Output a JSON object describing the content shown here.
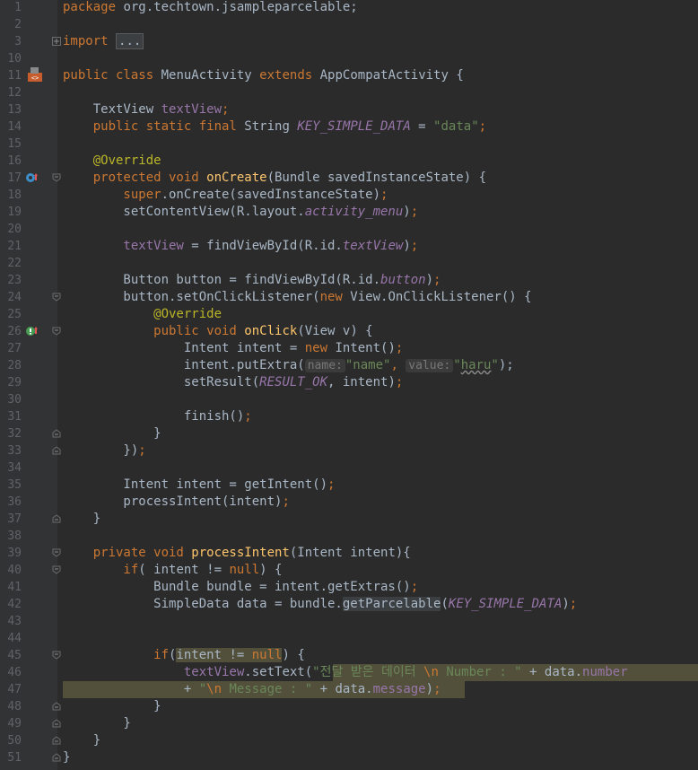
{
  "gutter": {
    "line_numbers": [
      "1",
      "2",
      "3",
      "10",
      "11",
      "12",
      "13",
      "14",
      "15",
      "16",
      "17",
      "18",
      "19",
      "20",
      "21",
      "22",
      "23",
      "24",
      "25",
      "26",
      "27",
      "28",
      "29",
      "30",
      "31",
      "32",
      "33",
      "34",
      "35",
      "36",
      "37",
      "38",
      "39",
      "40",
      "41",
      "42",
      "43",
      "44",
      "45",
      "46",
      "47",
      "48",
      "49",
      "50",
      "51"
    ]
  },
  "code": {
    "l1_kw": "package",
    "l1_rest": " org.techtown.jsampleparcelable;",
    "l3_kw": "import",
    "l3_folded": "...",
    "l11_a": "public class",
    "l11_b": " MenuActivity ",
    "l11_c": "extends",
    "l11_d": " AppCompatActivity {",
    "l13_a": "    TextView ",
    "l13_b": "textView",
    "l13_c": ";",
    "l14_a": "    public static final",
    "l14_b": " String ",
    "l14_c": "KEY_SIMPLE_DATA",
    "l14_d": " = ",
    "l14_e": "\"data\"",
    "l14_f": ";",
    "l16_a": "    @Override",
    "l17_a": "    protected void",
    "l17_b": " onCreate",
    "l17_c": "(Bundle savedInstanceState) {",
    "l18_a": "        super",
    "l18_b": ".onCreate(savedInstanceState)",
    "l18_c": ";",
    "l19_a": "        setContentView(R.layout.",
    "l19_b": "activity_menu",
    "l19_c": ")",
    "l19_d": ";",
    "l21_a": "        textView",
    "l21_b": " = findViewById(R.id.",
    "l21_c": "textView",
    "l21_d": ")",
    "l21_e": ";",
    "l23_a": "        Button button = findViewById(R.id.",
    "l23_b": "button",
    "l23_c": ")",
    "l23_d": ";",
    "l24_a": "        button.setOnClickListener(",
    "l24_b": "new",
    "l24_c": " View.OnClickListener() {",
    "l25_a": "            @Override",
    "l26_a": "            public void",
    "l26_b": " onClick",
    "l26_c": "(View v) {",
    "l27_a": "                Intent intent = ",
    "l27_b": "new",
    "l27_c": " Intent()",
    "l27_d": ";",
    "l28_a": "                intent.putExtra(",
    "l28_hint1": "name:",
    "l28_s1": "\"name\"",
    "l28_comma": ", ",
    "l28_hint2": "value:",
    "l28_s2q1": "\"",
    "l28_s2": "haru",
    "l28_s2q2": "\"",
    "l28_end": ");",
    "l29_a": "                setResult(",
    "l29_b": "RESULT_OK",
    "l29_c": ", intent)",
    "l29_d": ";",
    "l31_a": "                finish()",
    "l31_b": ";",
    "l32_a": "            }",
    "l33_a": "        })",
    "l33_b": ";",
    "l35_a": "        Intent intent = getIntent()",
    "l35_b": ";",
    "l36_a": "        processIntent(intent)",
    "l36_b": ";",
    "l37_a": "    }",
    "l39_a": "    private void",
    "l39_b": " processIntent",
    "l39_c": "(Intent intent){",
    "l40_a": "        if",
    "l40_b": "( intent != ",
    "l40_c": "null",
    "l40_d": ") {",
    "l41_a": "            Bundle bundle = intent.getExtras()",
    "l41_b": ";",
    "l42_a": "            SimpleData data = bundle.",
    "l42_b": "getParcelable",
    "l42_c": "(",
    "l42_d": "KEY_SIMPLE_DATA",
    "l42_e": ")",
    "l42_f": ";",
    "l45_a": "            if",
    "l45_b": "(",
    "l45_c": "intent != ",
    "l45_d": "null",
    "l45_e": ") {",
    "l46_a": "                textView",
    "l46_b": ".setText(",
    "l46_c": "\"전달 받은 데이터 ",
    "l46_d": "\\n",
    "l46_e": " Number : \"",
    "l46_f": " + data.",
    "l46_g": "number",
    "l47_a": "                + ",
    "l47_b": "\"",
    "l47_c": "\\n",
    "l47_d": " Message : \"",
    "l47_e": " + data.",
    "l47_f": "message",
    "l47_g": ")",
    "l47_h": ";",
    "l48_a": "            }",
    "l49_a": "        }",
    "l50_a": "    }",
    "l51_a": "}"
  },
  "colors": {
    "background": "#2b2b2b",
    "gutter": "#313335",
    "keyword": "#cc7832",
    "string": "#6a8759",
    "field": "#9876aa",
    "method": "#ffc66d",
    "annotation": "#bbb529",
    "text": "#a9b7c6",
    "warning_highlight": "#52503a"
  },
  "icons": {
    "class_icon": "android-layout-icon",
    "override_up": "implements-method-icon",
    "override_impl": "override-method-icon",
    "fold": "fold-marker-icon"
  }
}
